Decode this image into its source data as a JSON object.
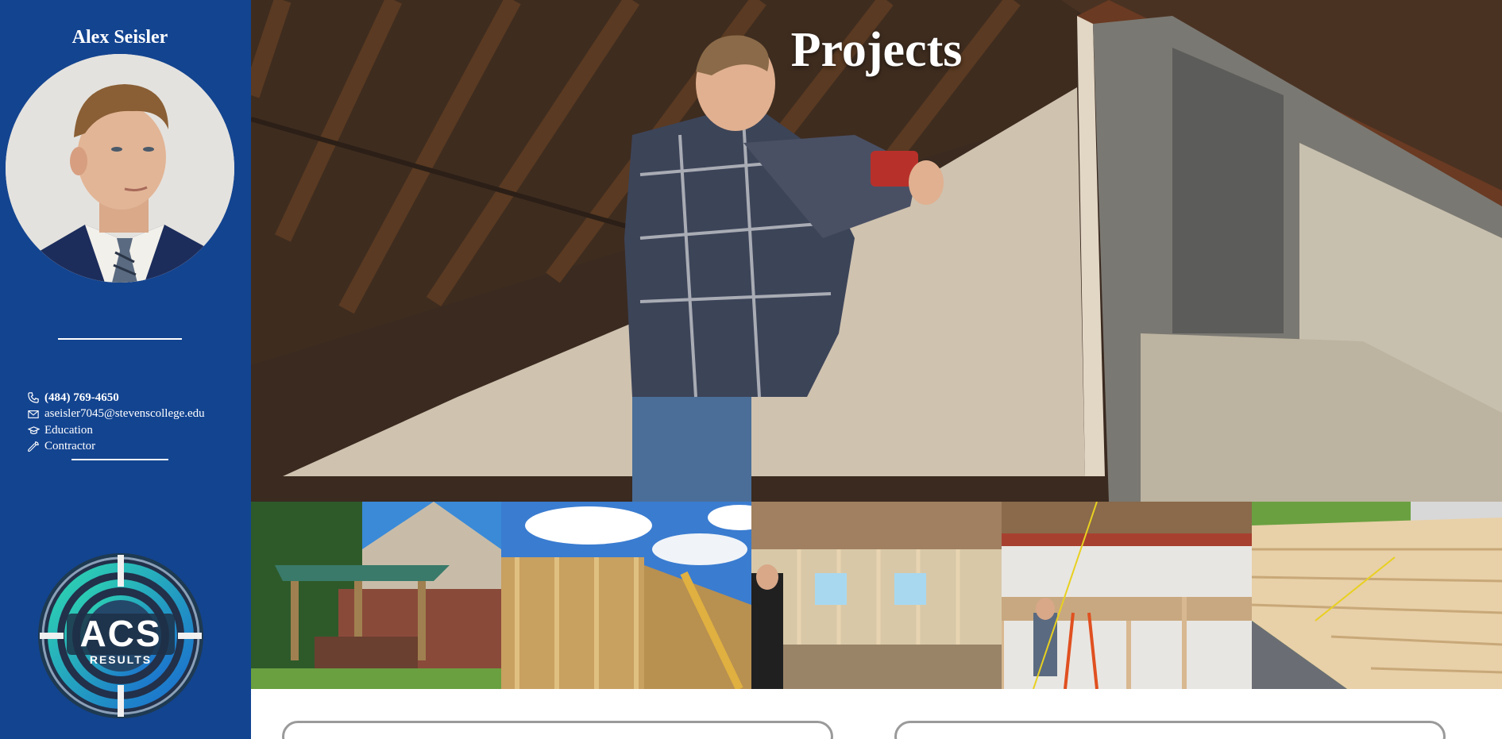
{
  "sidebar": {
    "name": "Alex Seisler",
    "contacts": [
      {
        "icon": "phone-icon",
        "text": "(484) 769-4650",
        "bold": true
      },
      {
        "icon": "mail-icon",
        "text": "aseisler7045@stevenscollege.edu",
        "bold": false
      },
      {
        "icon": "graduation-cap-icon",
        "text": "Education",
        "bold": false
      },
      {
        "icon": "wrench-icon",
        "text": "Contractor",
        "bold": false
      }
    ],
    "logo": {
      "main": "ACS",
      "sub": "RESULTS"
    }
  },
  "main": {
    "title": "Projects",
    "gallery": [
      {
        "name": "project-pergola-photo"
      },
      {
        "name": "project-wall-framing-photo"
      },
      {
        "name": "project-interior-framing-photo"
      },
      {
        "name": "project-ceiling-photo"
      },
      {
        "name": "project-roof-framing-photo"
      }
    ]
  },
  "colors": {
    "sidebar_bg": "#134490",
    "text": "#ffffff",
    "card_border": "#9a9a9a"
  }
}
